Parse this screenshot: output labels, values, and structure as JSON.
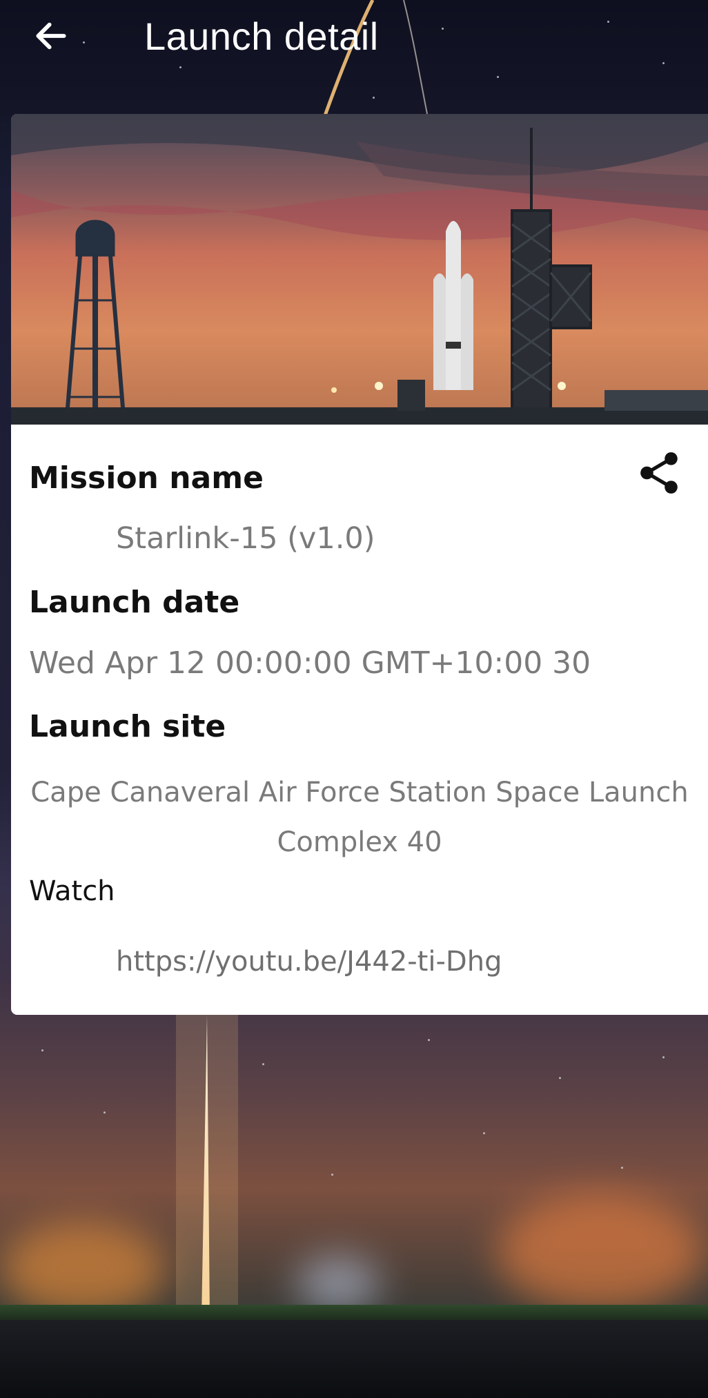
{
  "app_bar": {
    "title": "Launch detail",
    "back_icon": "arrow-left-icon"
  },
  "mission": {
    "name_label": "Mission name",
    "name_value": "Starlink-15 (v1.0)",
    "date_label": "Launch date",
    "date_value": "Wed Apr 12 00:00:00 GMT+10:00 30",
    "site_label": "Launch site",
    "site_value": "Cape Canaveral Air Force Station Space Launch Complex 40",
    "watch_label": "Watch",
    "watch_link": "https://youtu.be/J442-ti-Dhg",
    "share_icon": "share-icon"
  },
  "colors": {
    "label": "#111111",
    "value": "#7a7a7a",
    "card": "#ffffff",
    "title": "#ffffff"
  }
}
